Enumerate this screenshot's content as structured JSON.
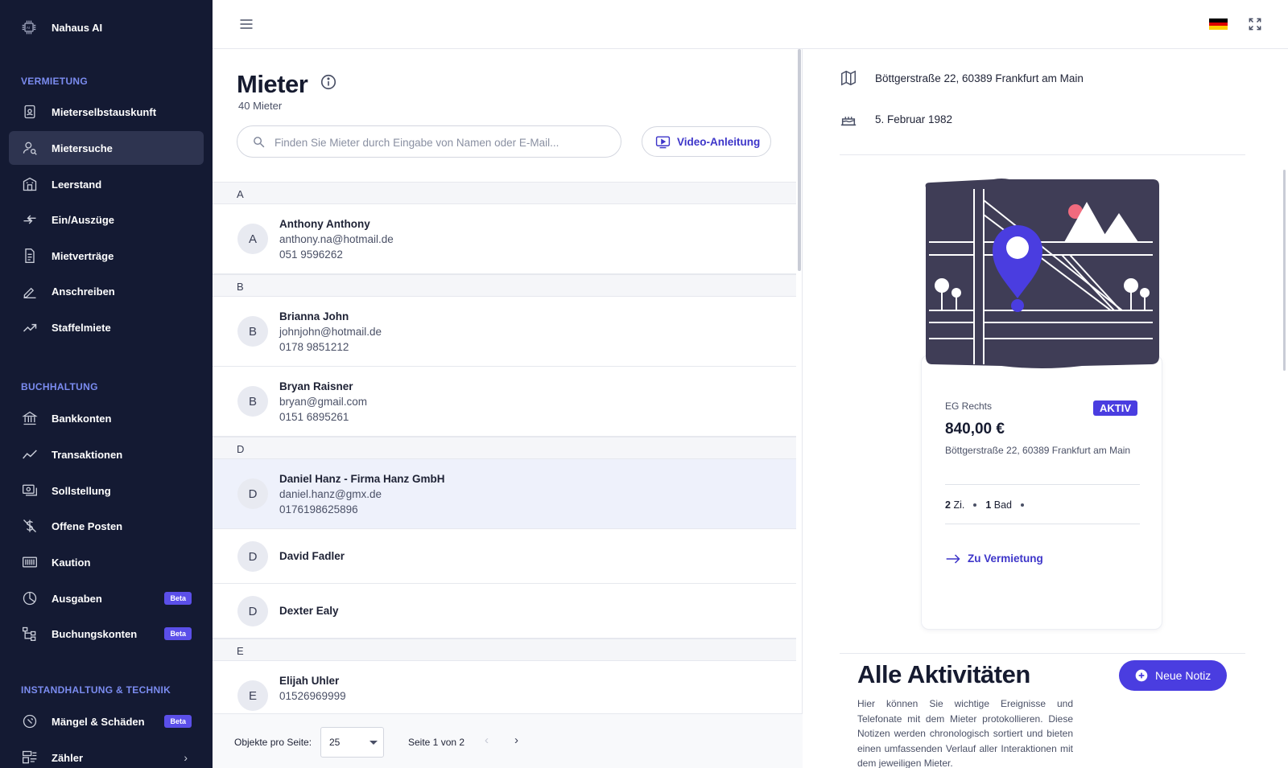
{
  "app": {
    "name": "Nahaus AI"
  },
  "sidebar": {
    "sections": [
      {
        "title": "VERMIETUNG",
        "items": [
          {
            "label": "Mieterselbstauskunft",
            "icon": "clipboard-user-icon"
          },
          {
            "label": "Mietersuche",
            "icon": "user-search-icon",
            "active": true
          },
          {
            "label": "Leerstand",
            "icon": "building-icon"
          },
          {
            "label": "Ein/Auszüge",
            "icon": "arrows-swap-icon"
          },
          {
            "label": "Mietverträge",
            "icon": "document-icon"
          },
          {
            "label": "Anschreiben",
            "icon": "pen-icon"
          },
          {
            "label": "Staffelmiete",
            "icon": "trend-up-icon"
          }
        ]
      },
      {
        "title": "BUCHHALTUNG",
        "items": [
          {
            "label": "Bankkonten",
            "icon": "bank-icon"
          },
          {
            "label": "Transaktionen",
            "icon": "chart-line-icon"
          },
          {
            "label": "Sollstellung",
            "icon": "invoice-icon"
          },
          {
            "label": "Offene Posten",
            "icon": "dollar-off-icon"
          },
          {
            "label": "Kaution",
            "icon": "safe-icon"
          },
          {
            "label": "Ausgaben",
            "icon": "pie-chart-icon",
            "badge": "Beta"
          },
          {
            "label": "Buchungskonten",
            "icon": "hierarchy-icon",
            "badge": "Beta"
          }
        ]
      },
      {
        "title": "INSTANDHALTUNG & TECHNIK",
        "items": [
          {
            "label": "Mängel & Schäden",
            "icon": "tool-circle-icon",
            "badge": "Beta"
          },
          {
            "label": "Zähler",
            "icon": "meter-icon",
            "chevron": "›"
          }
        ]
      }
    ]
  },
  "topbar": {
    "language_flag": "de",
    "flag_colors": [
      "#000000",
      "#DD0000",
      "#FFCE00"
    ]
  },
  "tenants": {
    "title": "Mieter",
    "count": "40 Mieter",
    "search_placeholder": "Finden Sie Mieter durch Eingabe von Namen oder E-Mail...",
    "video_button": "Video-Anleitung",
    "groups": [
      {
        "letter": "A",
        "rows": [
          {
            "initial": "A",
            "name": "Anthony Anthony",
            "email": "anthony.na@hotmail.de",
            "phone": "051 9596262"
          }
        ]
      },
      {
        "letter": "B",
        "rows": [
          {
            "initial": "B",
            "name": "Brianna John",
            "email": "johnjohn@hotmail.de",
            "phone": "0178 9851212"
          },
          {
            "initial": "B",
            "name": "Bryan Raisner",
            "email": "bryan@gmail.com",
            "phone": "0151 6895261"
          }
        ]
      },
      {
        "letter": "D",
        "rows": [
          {
            "initial": "D",
            "name": "Daniel Hanz - Firma Hanz GmbH",
            "email": "daniel.hanz@gmx.de",
            "phone": "0176198625896",
            "selected": true
          },
          {
            "initial": "D",
            "name": "David Fadler"
          },
          {
            "initial": "D",
            "name": "Dexter Ealy"
          }
        ]
      },
      {
        "letter": "E",
        "rows": [
          {
            "initial": "E",
            "name": "Elijah Uhler",
            "phone": "01526969999"
          }
        ]
      }
    ],
    "pagination": {
      "per_page_label": "Objekte pro Seite:",
      "per_page_value": "25",
      "page_info": "Seite 1 von 2",
      "prev": "‹",
      "next": "›"
    }
  },
  "detail": {
    "address": "Böttgerstraße 22, 60389 Frankfurt am Main",
    "birthday": "5. Februar 1982",
    "property": {
      "unit": "EG Rechts",
      "status": "AKTIV",
      "price": "840,00 €",
      "address": "Böttgerstraße 22, 60389 Frankfurt am Main",
      "rooms_value": "2",
      "rooms_unit": "Zi.",
      "baths_value": "1",
      "baths_unit": "Bad",
      "link": "Zu Vermietung"
    },
    "activities": {
      "title": "Alle Aktivitäten",
      "new_note_button": "Neue Notiz",
      "description": "Hier können Sie wichtige Ereignisse und Telefonate mit dem Mieter protokollieren. Diese Notizen werden chronologisch sortiert und bieten einen umfassenden Verlauf aller Interaktionen mit dem jeweiligen Mieter."
    }
  },
  "colors": {
    "sidebar_bg": "#141a33",
    "accent": "#4a3de0",
    "section_title": "#7b8cf0",
    "beta_badge": "#5b4fe9"
  }
}
